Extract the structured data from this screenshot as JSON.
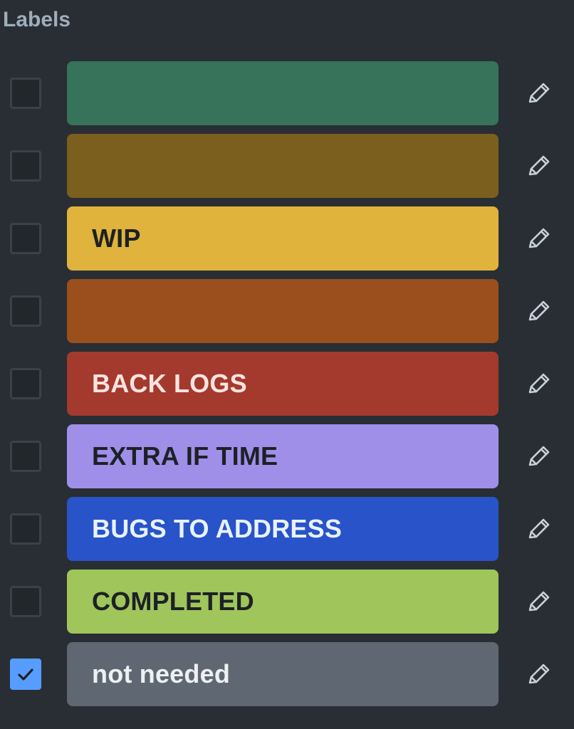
{
  "panel": {
    "title": "Labels"
  },
  "labels": [
    {
      "name": "",
      "color": "#37725a",
      "text_color": "#1d2125",
      "checked": false
    },
    {
      "name": "",
      "color": "#7b5f1e",
      "text_color": "#1d2125",
      "checked": false
    },
    {
      "name": "WIP",
      "color": "#dfb33c",
      "text_color": "#1d2125",
      "checked": false
    },
    {
      "name": "",
      "color": "#9a4f1c",
      "text_color": "#1d2125",
      "checked": false
    },
    {
      "name": "BACK LOGS",
      "color": "#a4392e",
      "text_color": "#ffe4e0",
      "checked": false
    },
    {
      "name": "EXTRA IF TIME",
      "color": "#9f8fe9",
      "text_color": "#1d2125",
      "checked": false
    },
    {
      "name": "BUGS TO ADDRESS",
      "color": "#2853c9",
      "text_color": "#e9f2ff",
      "checked": false
    },
    {
      "name": "COMPLETED",
      "color": "#9fc55b",
      "text_color": "#1d2125",
      "checked": false
    },
    {
      "name": "not needed",
      "color": "#5f6872",
      "text_color": "#eef1f4",
      "checked": true
    }
  ],
  "icons": {
    "checkbox_check": "check-icon",
    "edit": "pencil-icon"
  },
  "colors": {
    "background": "#282e33",
    "checkbox_checked": "#579dff",
    "heading": "#9fadbc"
  }
}
